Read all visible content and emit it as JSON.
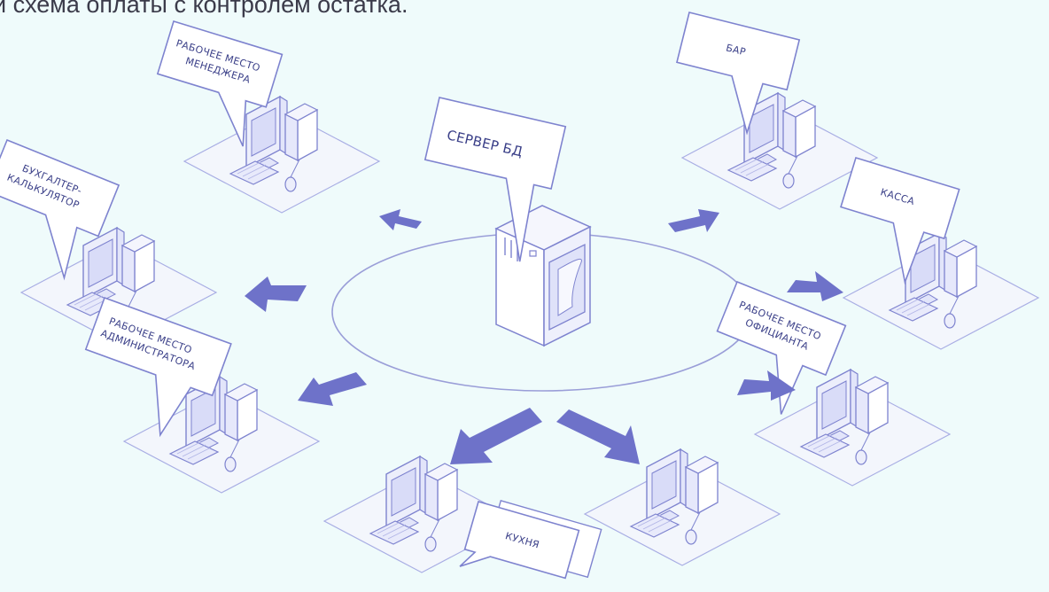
{
  "title": "и схема оплаты с контролем остатка.",
  "server": {
    "label": "СЕРВЕР БД"
  },
  "workstations": [
    {
      "id": "manager",
      "label_lines": [
        "РАБОЧЕЕ МЕСТО",
        "МЕНЕДЖЕРА"
      ]
    },
    {
      "id": "accountant",
      "label_lines": [
        "БУХГАЛТЕР-",
        "КАЛЬКУЛЯТОР"
      ]
    },
    {
      "id": "administrator",
      "label_lines": [
        "РАБОЧЕЕ МЕСТО",
        "АДМИНИСТРАТОРА"
      ]
    },
    {
      "id": "bar",
      "label_lines": [
        "БАР"
      ]
    },
    {
      "id": "cashier",
      "label_lines": [
        "КАССА"
      ]
    },
    {
      "id": "waiter",
      "label_lines": [
        "РАБОЧЕЕ МЕСТО",
        "ОФИЦИАНТА"
      ]
    },
    {
      "id": "kitchen",
      "label_lines": [
        "КУХНЯ"
      ]
    }
  ],
  "colors": {
    "background": "#effbfb",
    "outline": "#8b8fd4",
    "arrow": "#6e72c9",
    "screen": "#d9dcf8",
    "platform": "#f3f6fc",
    "text": "#3a3f88"
  }
}
